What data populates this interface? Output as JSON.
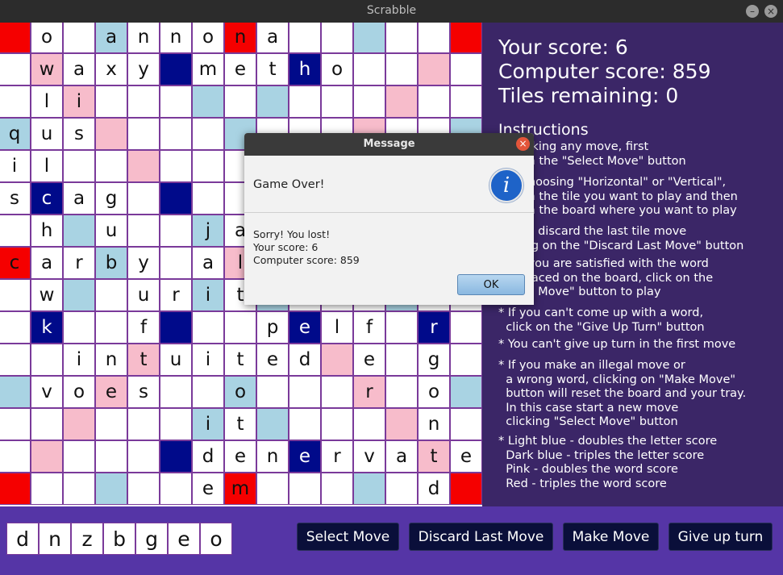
{
  "window": {
    "title": "Scrabble"
  },
  "board": {
    "colors": {
      "double_letter": "#a9d3e3",
      "triple_letter": "#000a8a",
      "double_word": "#f7bccb",
      "triple_word": "#f50000"
    },
    "rows": [
      [
        "",
        "o",
        "",
        "a",
        "n",
        "n",
        "o",
        "n",
        "a",
        "",
        "",
        "",
        "",
        ""
      ],
      [
        "",
        "w",
        "a",
        "x",
        "y",
        "",
        "m",
        "e",
        "t",
        "h",
        "o",
        "",
        "",
        ""
      ],
      [
        "",
        "l",
        "i",
        "",
        "",
        "",
        "",
        "",
        "",
        "",
        "",
        "",
        "",
        ""
      ],
      [
        "q",
        "u",
        "s",
        "",
        "",
        "",
        "",
        "",
        "",
        "",
        "",
        "",
        "",
        ""
      ],
      [
        "i",
        "l",
        "",
        "",
        "",
        "",
        "",
        "",
        "",
        "",
        "",
        "",
        "",
        ""
      ],
      [
        "s",
        "c",
        "a",
        "g",
        "",
        "",
        "",
        "",
        "",
        "",
        "",
        "",
        "",
        ""
      ],
      [
        "",
        "h",
        "",
        "u",
        "",
        "",
        "j",
        "a",
        "",
        "",
        "",
        "",
        "",
        ""
      ],
      [
        "c",
        "a",
        "r",
        "b",
        "y",
        "",
        "a",
        "l",
        "",
        "",
        "",
        "",
        "",
        ""
      ],
      [
        "",
        "w",
        "",
        "",
        "u",
        "r",
        "i",
        "t",
        "",
        "",
        "",
        "",
        "",
        ""
      ],
      [
        "",
        "k",
        "",
        "",
        "f",
        "",
        "",
        "",
        "p",
        "e",
        "l",
        "f",
        "",
        "r"
      ],
      [
        "",
        "",
        "i",
        "n",
        "t",
        "u",
        "i",
        "t",
        "e",
        "d",
        "",
        "e",
        "",
        "g"
      ],
      [
        "",
        "v",
        "o",
        "e",
        "s",
        "",
        "",
        "o",
        "",
        "",
        "",
        "r",
        "",
        "o"
      ],
      [
        "",
        "",
        "",
        "",
        "",
        "",
        "i",
        "t",
        "",
        "",
        "",
        "",
        "",
        "n"
      ],
      [
        "",
        "",
        "",
        "",
        "",
        "",
        "d",
        "e",
        "n",
        "e",
        "r",
        "v",
        "a",
        "t",
        "e"
      ],
      [
        "",
        "",
        "",
        "",
        "",
        "",
        "e",
        "m",
        "",
        "",
        "",
        "",
        "",
        "d"
      ]
    ]
  },
  "scores": {
    "your": "Your score: 6",
    "computer": "Computer score: 859",
    "tiles": "Tiles remaining: 0"
  },
  "instructions": {
    "heading": "Instructions",
    "tips": [
      "    making any move, first\n      on the \"Select Move\" button",
      "    r choosing \"Horizontal\" or \"Vertical\",\n      on the tile you want to play and then\n      on the board where you want to play",
      "    can discard the last tile move\n      ing on the \"Discard Last Move\" button",
      "     e you are satisfied with the word\n      placed on the board, click on the\n      ke Move\" button to play",
      "* If you can't come up with a word,\n  click on the \"Give Up Turn\" button",
      "* You can't give up turn in the first move",
      "* If you make an illegal move or\n  a wrong word, clicking on \"Make Move\"\n  button will reset the board and your tray.\n  In this case start a new move\n  clicking \"Select Move\" button",
      "* Light blue - doubles the letter score\n  Dark blue - triples the letter score\n  Pink - doubles the word score\n  Red - triples the word score"
    ]
  },
  "tray": [
    "d",
    "n",
    "z",
    "b",
    "g",
    "e",
    "o"
  ],
  "buttons": {
    "select": "Select Move",
    "discard": "Discard Last Move",
    "make": "Make Move",
    "give_up": "Give up turn"
  },
  "dialog": {
    "title": "Message",
    "heading": "Game Over!",
    "lines": [
      "Sorry! You lost!",
      "Your score: 6",
      "Computer score: 859"
    ],
    "ok": "OK",
    "icon": "info-icon",
    "icon_glyph": "i",
    "close_glyph": "×"
  },
  "window_controls": {
    "minimize": "–",
    "close": "×"
  }
}
